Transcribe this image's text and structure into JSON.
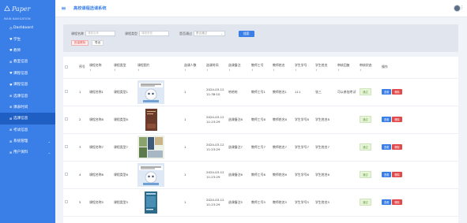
{
  "app": {
    "logo_text": "Paper",
    "nav_heading": "MAIN NAVIGATION",
    "title": "高校课程选课系统"
  },
  "colors": {
    "accent": "#3a7fe8",
    "active_nav": "#1f5fc4",
    "danger": "#e04a4a",
    "status": "#6b9f3f"
  },
  "sidebar": {
    "items": [
      {
        "label": "Dashboard",
        "icon": "gauge-icon",
        "has_children": false,
        "active": false
      },
      {
        "label": "学生",
        "icon": "heart-icon",
        "has_children": false,
        "active": false
      },
      {
        "label": "教师",
        "icon": "heart-icon",
        "has_children": false,
        "active": false
      },
      {
        "label": "教室信息",
        "icon": "grid-icon",
        "has_children": false,
        "active": false
      },
      {
        "label": "课程信息",
        "icon": "heart-icon",
        "has_children": false,
        "active": false
      },
      {
        "label": "课程信息",
        "icon": "heart-icon",
        "has_children": false,
        "active": false
      },
      {
        "label": "选课信息",
        "icon": "grid-icon",
        "has_children": false,
        "active": false
      },
      {
        "label": "课表时间",
        "icon": "grid-icon",
        "has_children": false,
        "active": false
      },
      {
        "label": "选课信息",
        "icon": "grid-icon",
        "has_children": false,
        "active": true
      },
      {
        "label": "考试信息",
        "icon": "grid-icon",
        "has_children": false,
        "active": false
      },
      {
        "label": "系统管理",
        "icon": "grid-icon",
        "has_children": true,
        "active": false
      },
      {
        "label": "用户资料",
        "icon": "grid-icon",
        "has_children": true,
        "active": false
      }
    ]
  },
  "filter": {
    "course_name_label": "课程名称",
    "course_name_placeholder": "课程名称",
    "course_type_label": "课程类型",
    "course_type_placeholder": "课程类型",
    "status_label": "是否通过",
    "status_placeholder": "是否通过",
    "search_button": "搜索",
    "batch_delete_button": "批量删除",
    "export_button": "导出"
  },
  "table": {
    "headers": [
      "序号",
      "课程名称",
      "课程类型",
      "课程图片",
      "选课人数",
      "选课时间",
      "选课备注",
      "教师工号",
      "教师姓名",
      "学生学号",
      "学生姓名",
      "审核回复",
      "审核状态",
      "操作"
    ],
    "sort_mark": "⇕",
    "rows": [
      {
        "index": "1",
        "name": "课程名称1",
        "type": "课程类型1",
        "image": "robot",
        "count": "1",
        "time": "2024-03-12 11:38:10",
        "remark": "哈哈哈",
        "teacher_no": "教师工号1",
        "teacher_name": "教师姓名1",
        "student_no": "111",
        "student_name": "张三",
        "reply": "可以参加考试",
        "status": "通过"
      },
      {
        "index": "2",
        "name": "课程名称8",
        "type": "课程类型8",
        "image": "book",
        "count": "1",
        "time": "2024-03-12 11:23:29",
        "remark": "选课备注8",
        "teacher_no": "教师工号8",
        "teacher_name": "教师姓名8",
        "student_no": "学生学号8",
        "student_name": "学生姓名8",
        "reply": "",
        "status": "通过"
      },
      {
        "index": "3",
        "name": "课程名称7",
        "type": "课程类型7",
        "image": "collage",
        "count": "1",
        "time": "2024-03-12 11:23:29",
        "remark": "选课备注7",
        "teacher_no": "教师工号7",
        "teacher_name": "教师姓名7",
        "student_no": "学生学号7",
        "student_name": "学生姓名7",
        "reply": "",
        "status": "通过"
      },
      {
        "index": "4",
        "name": "课程名称6",
        "type": "课程类型6",
        "image": "robot",
        "count": "1",
        "time": "2024-03-12 11:23:29",
        "remark": "选课备注6",
        "teacher_no": "教师工号6",
        "teacher_name": "教师姓名6",
        "student_no": "学生学号6",
        "student_name": "学生姓名6",
        "reply": "",
        "status": "通过"
      },
      {
        "index": "5",
        "name": "课程名称5",
        "type": "课程类型5",
        "image": "poster",
        "count": "1",
        "time": "2024-03-12 11:23:29",
        "remark": "选课备注5",
        "teacher_no": "教师工号5",
        "teacher_name": "教师姓名5",
        "student_no": "学生学号5",
        "student_name": "学生姓名5",
        "reply": "",
        "status": "通过"
      }
    ],
    "actions": {
      "view": "查看",
      "delete": "删除"
    }
  }
}
